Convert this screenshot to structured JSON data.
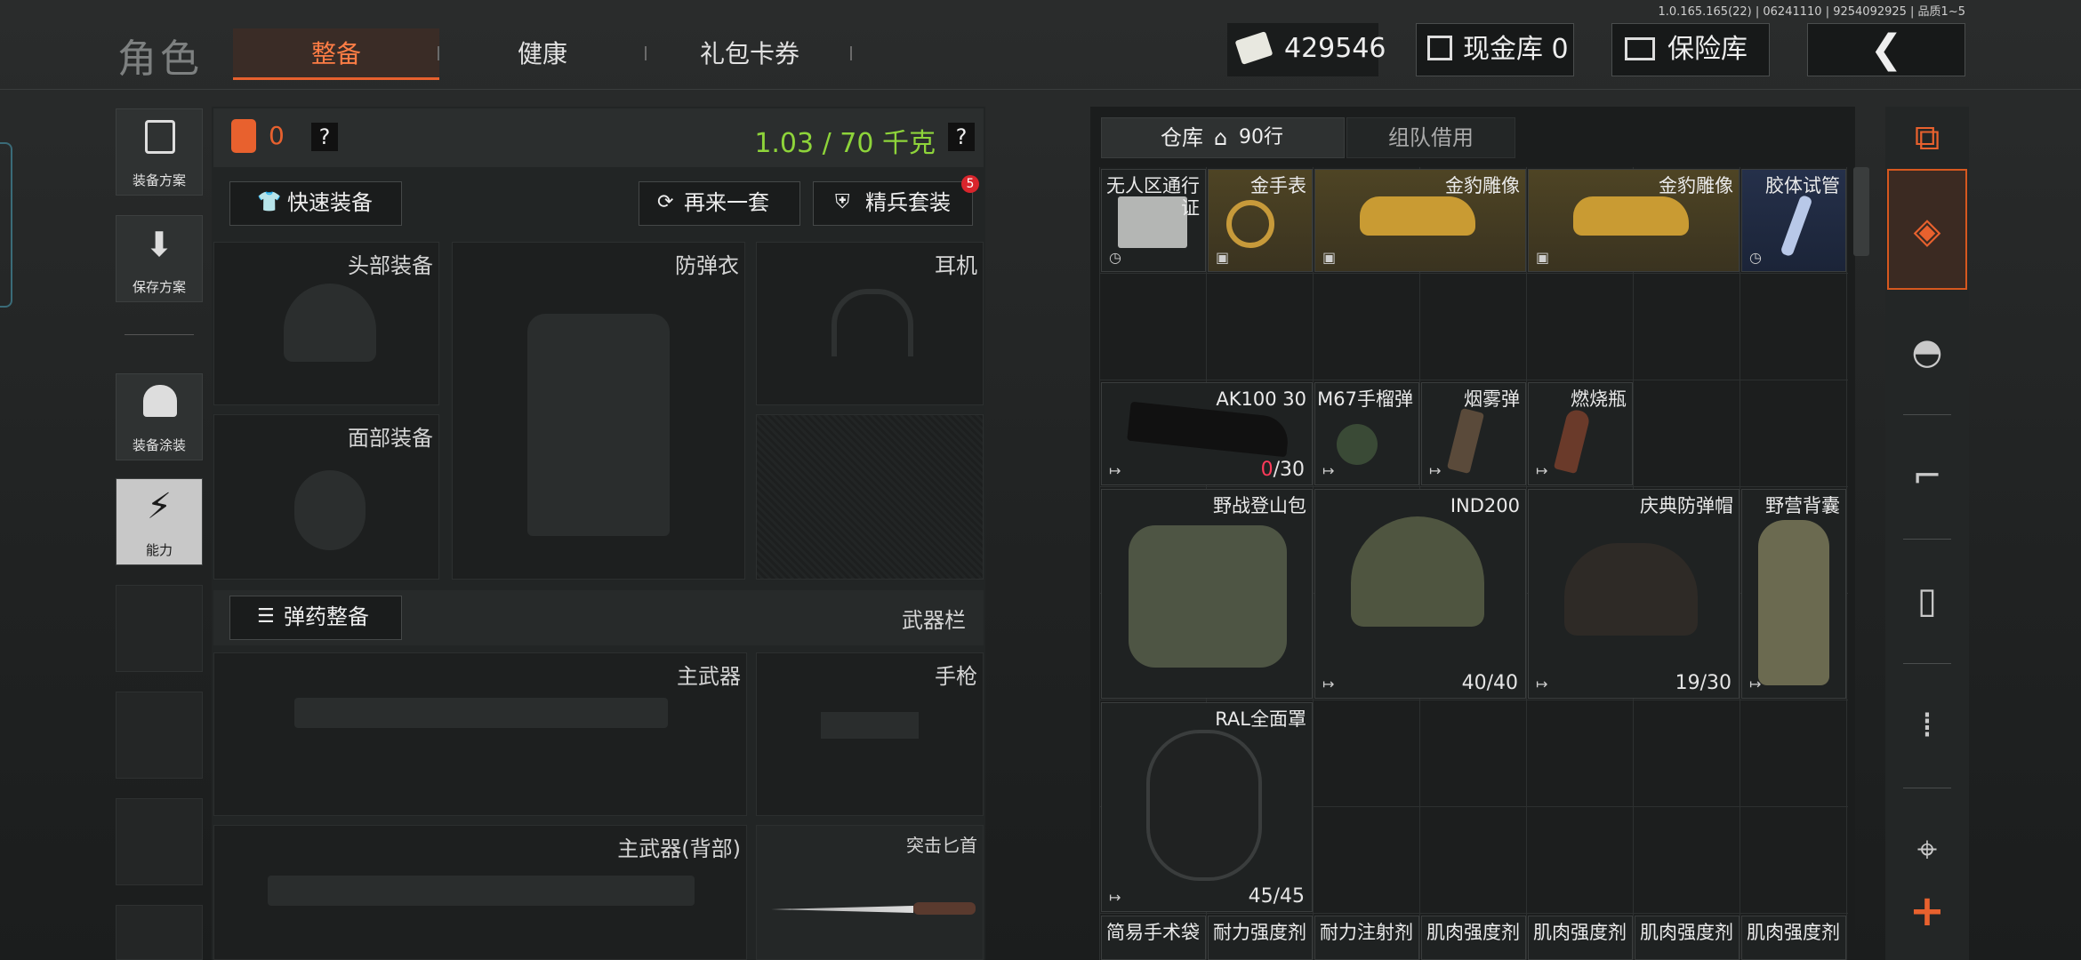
{
  "version": "1.0.165.165(22) | 06241110 | 9254092925 | 品质1~5",
  "header": {
    "role": "角色",
    "tabs": [
      "整备",
      "健康",
      "礼包卡券"
    ],
    "money": "429546",
    "cash_vault": "现金库 0",
    "safe": "保险库",
    "back_icon": "chevron-left-icon"
  },
  "sidebar": {
    "loadout_plan": "装备方案",
    "save_plan": "保存方案",
    "paint": "装备涂装",
    "ability": "能力"
  },
  "loadout": {
    "armor_count": "0",
    "weight": "1.03 / 70 千克",
    "quick_equip": "快速装备",
    "again": "再来一套",
    "elite": "精兵套装",
    "elite_badge": "5",
    "head": "头部装备",
    "vest": "防弹衣",
    "headset": "耳机",
    "face": "面部装备",
    "ammo": "弹药整备",
    "weapon_bar": "武器栏",
    "primary": "主武器",
    "pistol": "手枪",
    "primary_back": "主武器(背部)",
    "dagger": "突击匕首"
  },
  "storage": {
    "tab_storage": "仓库",
    "rows": "90行",
    "tab_team": "组队借用",
    "items": [
      {
        "name": "无人区通行证",
        "count": ""
      },
      {
        "name": "金手表",
        "count": ""
      },
      {
        "name": "金豹雕像",
        "count": ""
      },
      {
        "name": "金豹雕像",
        "count": ""
      },
      {
        "name": "胶体试管",
        "count": ""
      },
      {
        "name": "AK100 30",
        "count_red": "0",
        "count": "/30"
      },
      {
        "name": "M67手榴弹",
        "count": ""
      },
      {
        "name": "烟雾弹",
        "count": ""
      },
      {
        "name": "燃烧瓶",
        "count": ""
      },
      {
        "name": "野战登山包",
        "count": ""
      },
      {
        "name": "IND200",
        "count": "40/40"
      },
      {
        "name": "庆典防弹帽",
        "count": "19/30"
      },
      {
        "name": "野营背囊",
        "count": ""
      },
      {
        "name": "RAL全面罩",
        "count": "45/45"
      },
      {
        "name": "简易手术袋",
        "count": ""
      },
      {
        "name": "耐力强度剂",
        "count": ""
      },
      {
        "name": "耐力注射剂",
        "count": ""
      },
      {
        "name": "肌肉强度剂",
        "count": ""
      },
      {
        "name": "肌肉强度剂",
        "count": ""
      },
      {
        "name": "肌肉强度剂",
        "count": ""
      },
      {
        "name": "肌肉强度剂",
        "count": ""
      }
    ]
  },
  "right_tabs": [
    "sort-icon",
    "storage-icon",
    "helmet-icon",
    "rifle-icon",
    "magazine-icon",
    "ammo-icon",
    "scope-icon",
    "plus-icon"
  ],
  "colors": {
    "accent": "#e8612e",
    "weight": "#8ed43a",
    "gold": "#4e4424"
  }
}
